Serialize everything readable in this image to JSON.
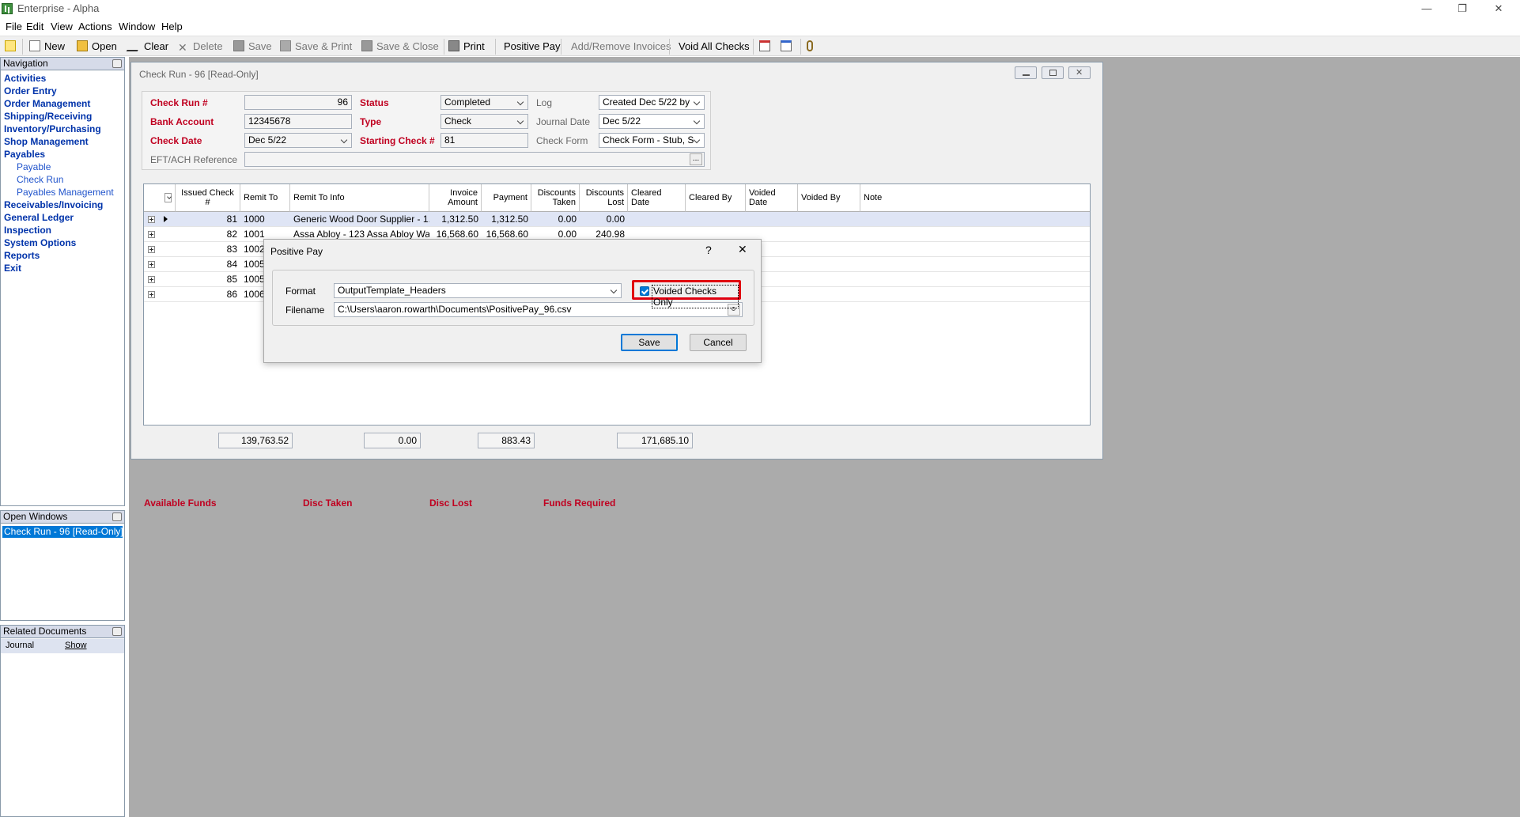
{
  "window": {
    "title": "Enterprise - Alpha"
  },
  "menu": [
    "File",
    "Edit",
    "View",
    "Actions",
    "Window",
    "Help"
  ],
  "toolbar": {
    "new": "New",
    "open": "Open",
    "clear": "Clear",
    "delete": "Delete",
    "save": "Save",
    "save_print": "Save & Print",
    "save_close": "Save & Close",
    "print": "Print",
    "positive_pay": "Positive Pay",
    "add_remove_invoices": "Add/Remove Invoices",
    "void_all_checks": "Void All Checks"
  },
  "navigation": {
    "title": "Navigation",
    "items": [
      "Activities",
      "Order Entry",
      "Order Management",
      "Shipping/Receiving",
      "Inventory/Purchasing",
      "Shop Management",
      "Payables"
    ],
    "payables_sub": [
      "Payable",
      "Check Run",
      "Payables Management"
    ],
    "items_after": [
      "Receivables/Invoicing",
      "General Ledger",
      "Inspection",
      "System Options",
      "Reports",
      "Exit"
    ]
  },
  "open_windows": {
    "title": "Open Windows",
    "items": [
      "Check Run - 96 [Read-Only]"
    ]
  },
  "related_documents": {
    "title": "Related Documents",
    "row_label": "Journal",
    "row_link": "Show"
  },
  "check_run": {
    "title": "Check Run - 96 [Read-Only]",
    "labels": {
      "check_run": "Check Run #",
      "bank_account": "Bank Account",
      "check_date": "Check Date",
      "eft_ach": "EFT/ACH Reference",
      "status": "Status",
      "type": "Type",
      "starting_check": "Starting Check #",
      "log": "Log",
      "journal_date": "Journal Date",
      "check_form": "Check Form"
    },
    "values": {
      "check_run": "96",
      "bank_account": "12345678",
      "check_date": "Dec 5/22",
      "status": "Completed",
      "type": "Check",
      "starting_check": "81",
      "log": "Created Dec 5/22 by",
      "journal_date": "Dec 5/22",
      "check_form": "Check Form - Stub, S",
      "eft_ach": "",
      "eft_button": "..."
    },
    "grid": {
      "headers": {
        "issued": "Issued Check #",
        "remit_to": "Remit To",
        "remit_info": "Remit To Info",
        "invoice_amount": "Invoice Amount",
        "payment": "Payment",
        "disc_taken": "Discounts Taken",
        "disc_lost": "Discounts Lost",
        "cleared_date": "Cleared Date",
        "cleared_by": "Cleared By",
        "voided_date": "Voided Date",
        "voided_by": "Voided By",
        "note": "Note"
      },
      "rows": [
        {
          "check": "81",
          "remit": "1000",
          "info": "Generic Wood Door Supplier - 1...",
          "invoice": "1,312.50",
          "payment": "1,312.50",
          "taken": "0.00",
          "lost": "0.00"
        },
        {
          "check": "82",
          "remit": "1001",
          "info": "Assa Abloy - 123 Assa Abloy Wa...",
          "invoice": "16,568.60",
          "payment": "16,568.60",
          "taken": "0.00",
          "lost": "240.98"
        },
        {
          "check": "83",
          "remit": "1002",
          "info": "",
          "invoice": "",
          "payment": "",
          "taken": "",
          "lost": ""
        },
        {
          "check": "84",
          "remit": "1005",
          "info": "",
          "invoice": "",
          "payment": "",
          "taken": "",
          "lost": ""
        },
        {
          "check": "85",
          "remit": "1005",
          "info": "",
          "invoice": "",
          "payment": "",
          "taken": "",
          "lost": ""
        },
        {
          "check": "86",
          "remit": "1006",
          "info": "",
          "invoice": "",
          "payment": "",
          "taken": "",
          "lost": ""
        }
      ]
    },
    "totals": {
      "available_label": "Available Funds",
      "available": "139,763.52",
      "disc_taken_label": "Disc Taken",
      "disc_taken": "0.00",
      "disc_lost_label": "Disc Lost",
      "disc_lost": "883.43",
      "required_label": "Funds Required",
      "required": "171,685.10"
    }
  },
  "positive_pay": {
    "title": "Positive Pay",
    "help": "?",
    "close": "✕",
    "format_label": "Format",
    "format_value": "OutputTemplate_Headers",
    "filename_label": "Filename",
    "filename_value": "C:\\Users\\aaron.rowarth\\Documents\\PositivePay_96.csv",
    "voided_only_label": "Voided Checks Only",
    "save": "Save",
    "cancel": "Cancel"
  },
  "colors": {
    "required_label": "#c00020",
    "nav_link": "#0033aa",
    "workspace": "#ababab",
    "highlight": "#e00010"
  }
}
